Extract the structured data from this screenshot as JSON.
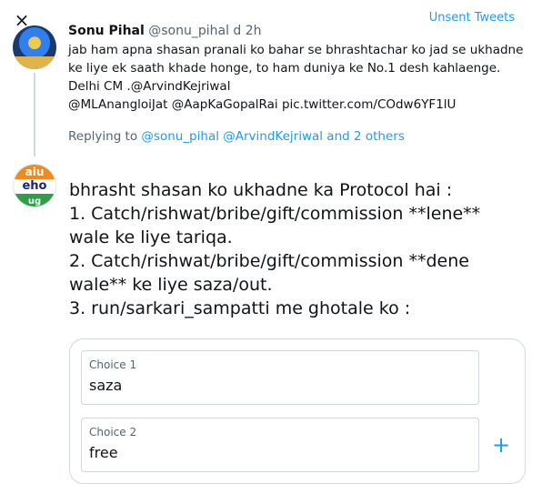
{
  "modal": {
    "close_icon": "×",
    "unsent_label": "Unsent Tweets"
  },
  "parent_tweet": {
    "name": "Sonu Pihal",
    "handle": "@sonu_pihal",
    "time": "d 2h",
    "lines": [
      "jab ham apna shasan pranali ko bahar se bhrashtachar ko jad se ukhadne",
      "ke liye ek saath khade honge, to ham duniya ke No.1 desh kahlaenge.",
      "Delhi CM .@ArvindKejriwal",
      "@MLAnangloiJat @AapKaGopalRai pic.twitter.com/COdw6YF1lU"
    ],
    "replying_prefix": "Replying to",
    "replying_mentions": "@sonu_pihal @ArvindKejriwal and 2 others"
  },
  "reply": {
    "avatar_text": [
      "aiu",
      "eho",
      "ug"
    ],
    "lines": [
      "bhrasht shasan ko ukhadne ka Protocol hai :",
      "1. Catch/rishwat/bribe/gift/commission **lene**",
      "wale ke liye tariqa.",
      "2. Catch/rishwat/bribe/gift/commission **dene",
      "wale** ke liye saza/out.",
      "3. run/sarkari_sampatti me ghotale ko :"
    ]
  },
  "poll": {
    "choices": [
      {
        "label": "Choice 1",
        "value": "saza"
      },
      {
        "label": "Choice 2",
        "value": "free"
      }
    ],
    "add_icon": "+"
  }
}
